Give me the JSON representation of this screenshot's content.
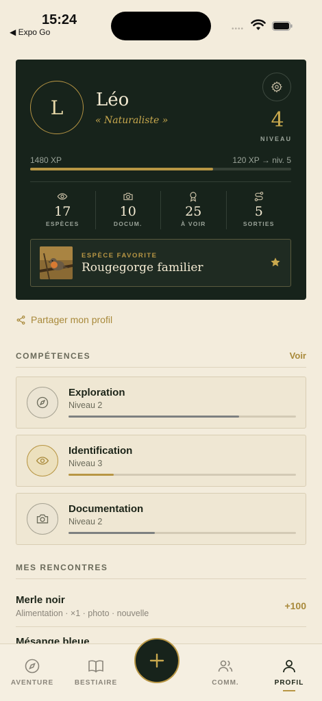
{
  "status_bar": {
    "time": "15:24",
    "back_app": "◀ Expo Go"
  },
  "profile": {
    "avatar_initial": "L",
    "name": "Léo",
    "title": "« Naturaliste »",
    "level_value": "4",
    "level_label": "NIVEAU",
    "xp_total": "1480 XP",
    "xp_next": "120 XP → niv. 5",
    "xp_progress": 0.7
  },
  "stats": [
    {
      "icon": "eye-icon",
      "value": "17",
      "label": "ESPÈCES"
    },
    {
      "icon": "camera-icon",
      "value": "10",
      "label": "DOCUM."
    },
    {
      "icon": "award-icon",
      "value": "25",
      "label": "À VOIR"
    },
    {
      "icon": "route-icon",
      "value": "5",
      "label": "SORTIES"
    }
  ],
  "favorite": {
    "label": "ESPÈCE FAVORITE",
    "name": "Rougegorge familier"
  },
  "share_label": "Partager mon profil",
  "skills_section": {
    "title": "COMPÉTENCES",
    "link": "Voir"
  },
  "skills": [
    {
      "name": "Exploration",
      "level": "Niveau 2",
      "progress": 0.75,
      "icon": "compass-icon"
    },
    {
      "name": "Identification",
      "level": "Niveau 3",
      "progress": 0.2,
      "icon": "eye-icon"
    },
    {
      "name": "Documentation",
      "level": "Niveau 2",
      "progress": 0.38,
      "icon": "camera-icon"
    }
  ],
  "encounters_section": {
    "title": "MES RENCONTRES"
  },
  "encounters": [
    {
      "name": "Merle noir",
      "meta": "Alimentation · ×1 · photo · nouvelle",
      "xp": "+100"
    },
    {
      "name": "Mésange bleue"
    }
  ],
  "tabs": [
    {
      "label": "AVENTURE",
      "icon": "compass-icon"
    },
    {
      "label": "BESTIAIRE",
      "icon": "book-icon"
    },
    {
      "label": "COMM.",
      "icon": "users-icon"
    },
    {
      "label": "PROFIL",
      "icon": "user-icon",
      "active": true
    }
  ],
  "colors": {
    "accent": "#b89644",
    "card": "#17231b",
    "background": "#f3ecdc"
  }
}
